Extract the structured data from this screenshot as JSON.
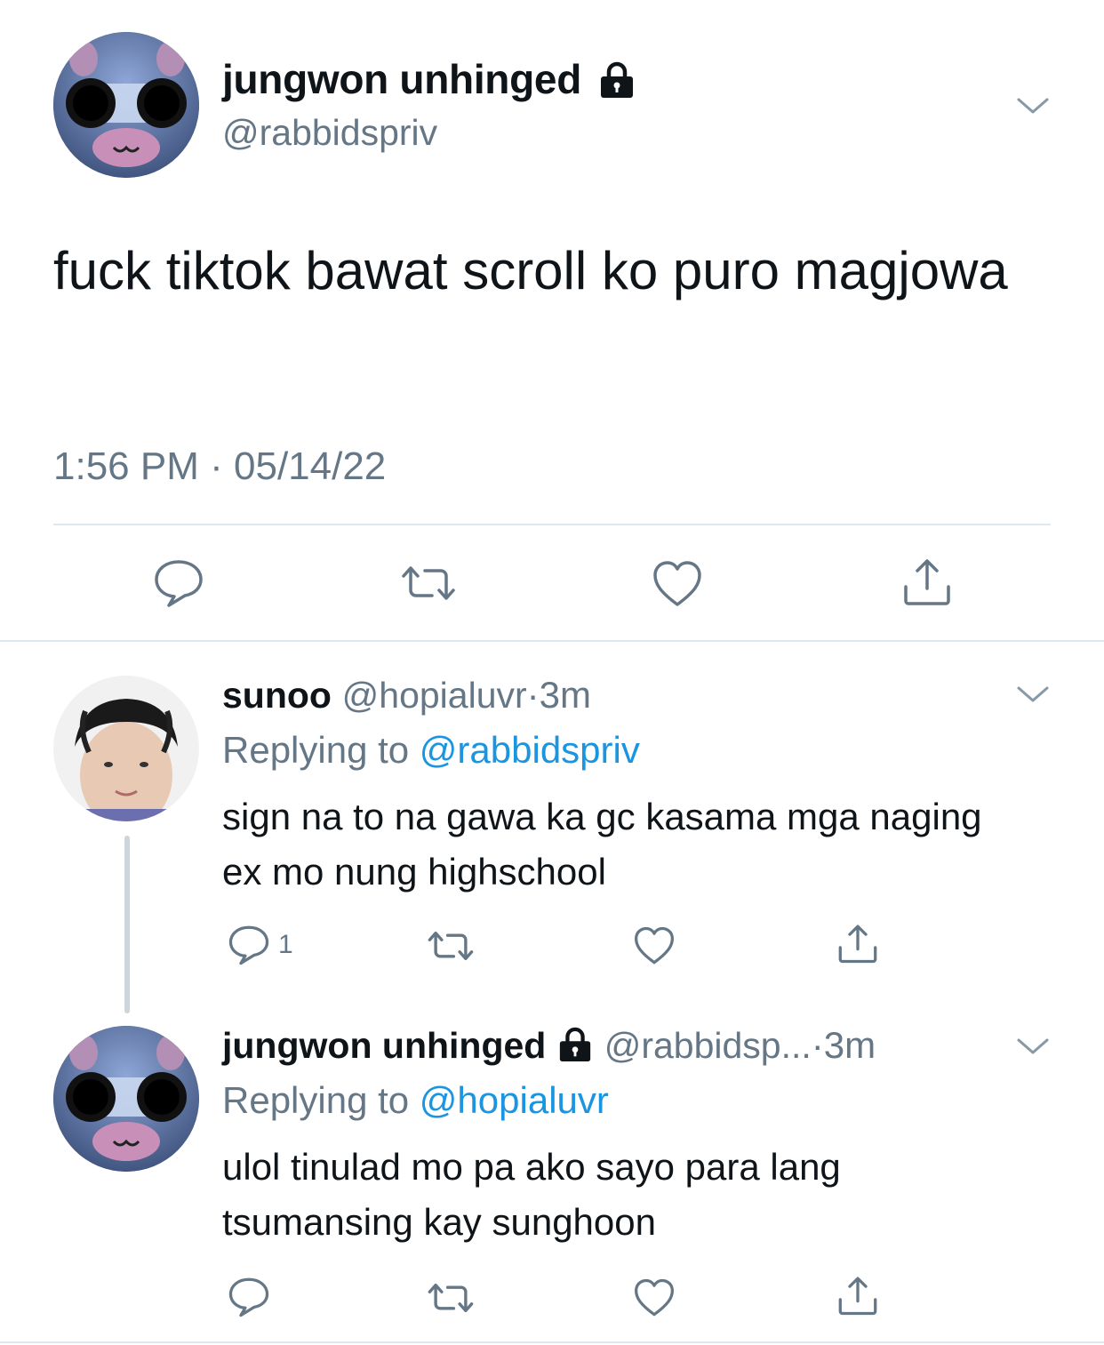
{
  "main_tweet": {
    "name": "jungwon unhinged",
    "handle": "@rabbidspriv",
    "text": "fuck tiktok bawat scroll ko puro magjowa",
    "time": "1:56 PM",
    "separator": "·",
    "date": "05/14/22",
    "icons": [
      "reply-icon",
      "retweet-icon",
      "like-icon",
      "share-icon"
    ]
  },
  "replies": [
    {
      "name": "sunoo",
      "handle": "@hopialuvr",
      "dot": "·",
      "age": "3m",
      "replying_prefix": "Replying to",
      "replying_handle": "@rabbidspriv",
      "text": "sign na to na gawa ka gc kasama mga naging ex mo nung highschool",
      "reply_count": "1"
    },
    {
      "name": "jungwon unhinged",
      "handle": "@rabbidsp...",
      "dot": "·",
      "age": "3m",
      "replying_prefix": "Replying to",
      "replying_handle": "@hopialuvr",
      "text": "ulol tinulad mo pa ako sayo para lang tsumansing kay sunghoon",
      "reply_count": ""
    }
  ],
  "colors": {
    "text": "#0f1419",
    "muted": "#657786",
    "link": "#1b95e0",
    "divider": "#e1e8ed"
  }
}
